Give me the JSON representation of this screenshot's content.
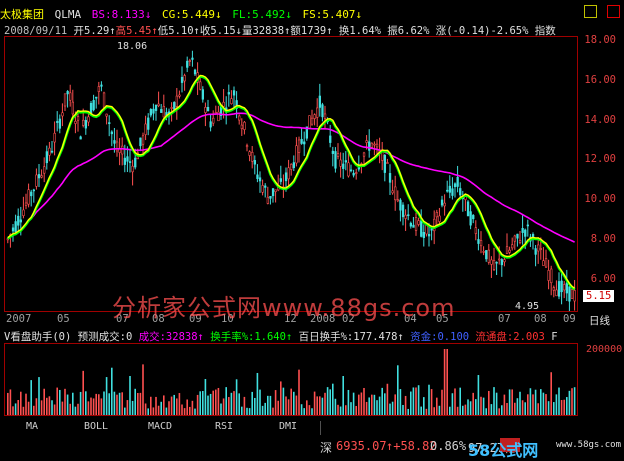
{
  "header": {
    "stock_name": "太极集团",
    "indicator": "QLMA",
    "bs": "BS:8.133↓",
    "cg": "CG:5.449↓",
    "fl": "FL:5.492↓",
    "fs": "FS:5.407↓"
  },
  "subheader": {
    "date": "2008/09/11",
    "open": "开5.29↑",
    "high": "高5.45↑",
    "low": "低5.10↑",
    "close": "收5.15↓",
    "volume": "量32838↑",
    "amount": "额1739↑",
    "turnover": "换1.64%",
    "amplitude": "振6.62%",
    "change": "涨(-0.14)-2.65%",
    "index": "指数"
  },
  "price_axis": {
    "ticks": [
      "18.00",
      "16.00",
      "14.00",
      "12.00",
      "10.00",
      "8.00",
      "6.00"
    ],
    "current_label": "5.15",
    "max_label": "18.06",
    "min_label": "4.95"
  },
  "x_axis": {
    "labels": [
      "2007",
      "05",
      "07",
      "08",
      "09",
      "10",
      "12",
      "2008",
      "02",
      "04",
      "05",
      "07",
      "08",
      "09"
    ],
    "unit_label": "日线"
  },
  "volume_header": {
    "name": "V看盘助手(0)",
    "forecast": "预测成交:0",
    "volume": "成交:32838↑",
    "turnover_rate": "换手率%:1.640↑",
    "hundred_day": "百日换手%:177.478↑",
    "fund": "资金:0.100",
    "flow": "流通盘:2.003",
    "right_label": "F"
  },
  "volume_axis": {
    "tick": "200000"
  },
  "tabs": [
    "MA",
    "BOLL",
    "MACD",
    "RSI",
    "DMI"
  ],
  "footer": {
    "market": "深",
    "index_value": "6935.07",
    "change": "↑+58.82",
    "percent": "0.86%",
    "turnover": "97.27亿",
    "site_left": "58公式网",
    "site_right": "www.58gs.com"
  },
  "watermark": "分析家公式网www.88gs.com",
  "colors": {
    "ma_short": "#ffff00",
    "ma_green": "#00ff00",
    "ma_long": "#ff00ff",
    "candle_up": "#ff5050",
    "candle_down": "#40e0e0",
    "grid_border": "#a00000"
  }
}
